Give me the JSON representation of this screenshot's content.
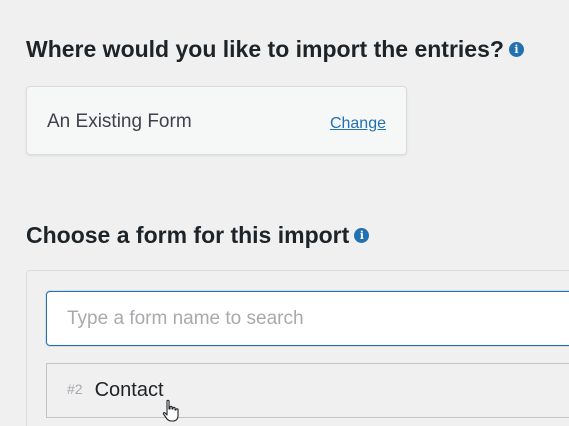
{
  "import_target": {
    "heading": "Where would you like to import the entries?",
    "info_icon": "info-icon",
    "selected_option": "An Existing Form",
    "change_link": "Change"
  },
  "form_chooser": {
    "heading": "Choose a form for this import",
    "info_icon": "info-icon",
    "search_placeholder": "Type a form name to search",
    "search_value": "",
    "results": [
      {
        "id_label": "#2",
        "name": "Contact"
      }
    ]
  },
  "cursor": "hand-pointer-icon",
  "colors": {
    "accent": "#2271b1",
    "background": "#f0f0f1"
  }
}
